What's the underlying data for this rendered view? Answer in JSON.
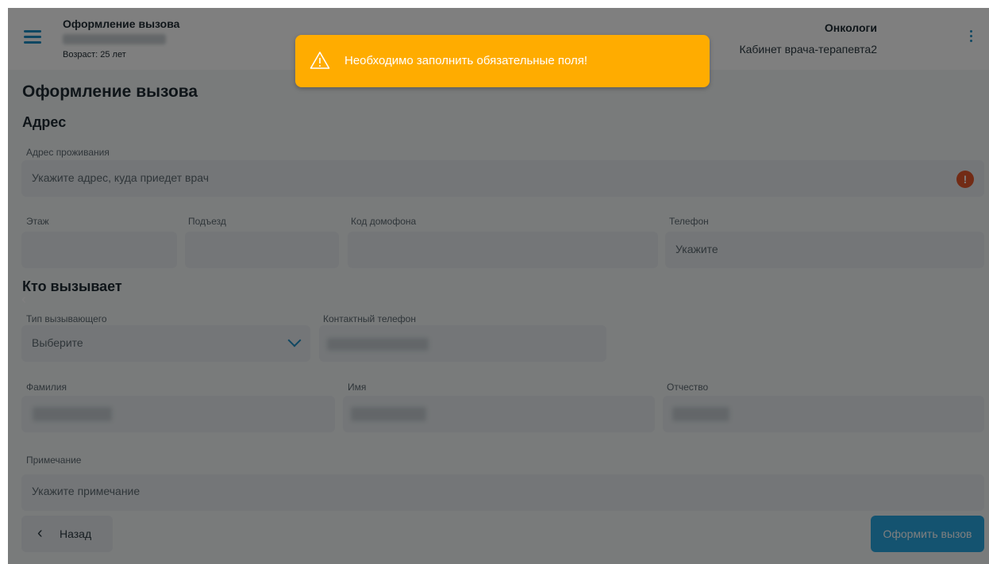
{
  "header": {
    "patient_name": "Оформление вызова",
    "patient_age": "Возраст: 25 лет",
    "organization": "Онкологи",
    "cabinet": "Кабинет врача-терапевта2"
  },
  "page": {
    "title": "Оформление вызова"
  },
  "address": {
    "section_title": "Адрес",
    "residence_label": "Адрес проживания",
    "residence_placeholder": "Укажите адрес, куда приедет врач",
    "floor_label": "Этаж",
    "entrance_label": "Подъезд",
    "intercom_label": "Код домофона",
    "phone_label": "Телефон",
    "phone_placeholder": "Укажите"
  },
  "caller": {
    "section_title": "Кто вызывает",
    "type_label": "Тип вызывающего",
    "type_value": "Выберите",
    "contact_phone_label": "Контактный телефон",
    "surname_label": "Фамилия",
    "name_label": "Имя",
    "patronymic_label": "Отчество",
    "note_label": "Примечание",
    "note_placeholder": "Укажите примечание"
  },
  "footer": {
    "back_label": "Назад",
    "submit_label": "Оформить вызов"
  },
  "toast": {
    "message": "Необходимо заполнить обязательные поля!"
  },
  "icons": [
    "menu-icon",
    "more-vertical-icon",
    "warning-icon",
    "error-icon",
    "chevron-down-icon",
    "chevron-left-icon"
  ],
  "colors": {
    "accent": "#29a7e0",
    "warning": "#ffac00",
    "error": "#e4562a",
    "overlay": "rgba(0,0,0,0.5)"
  }
}
